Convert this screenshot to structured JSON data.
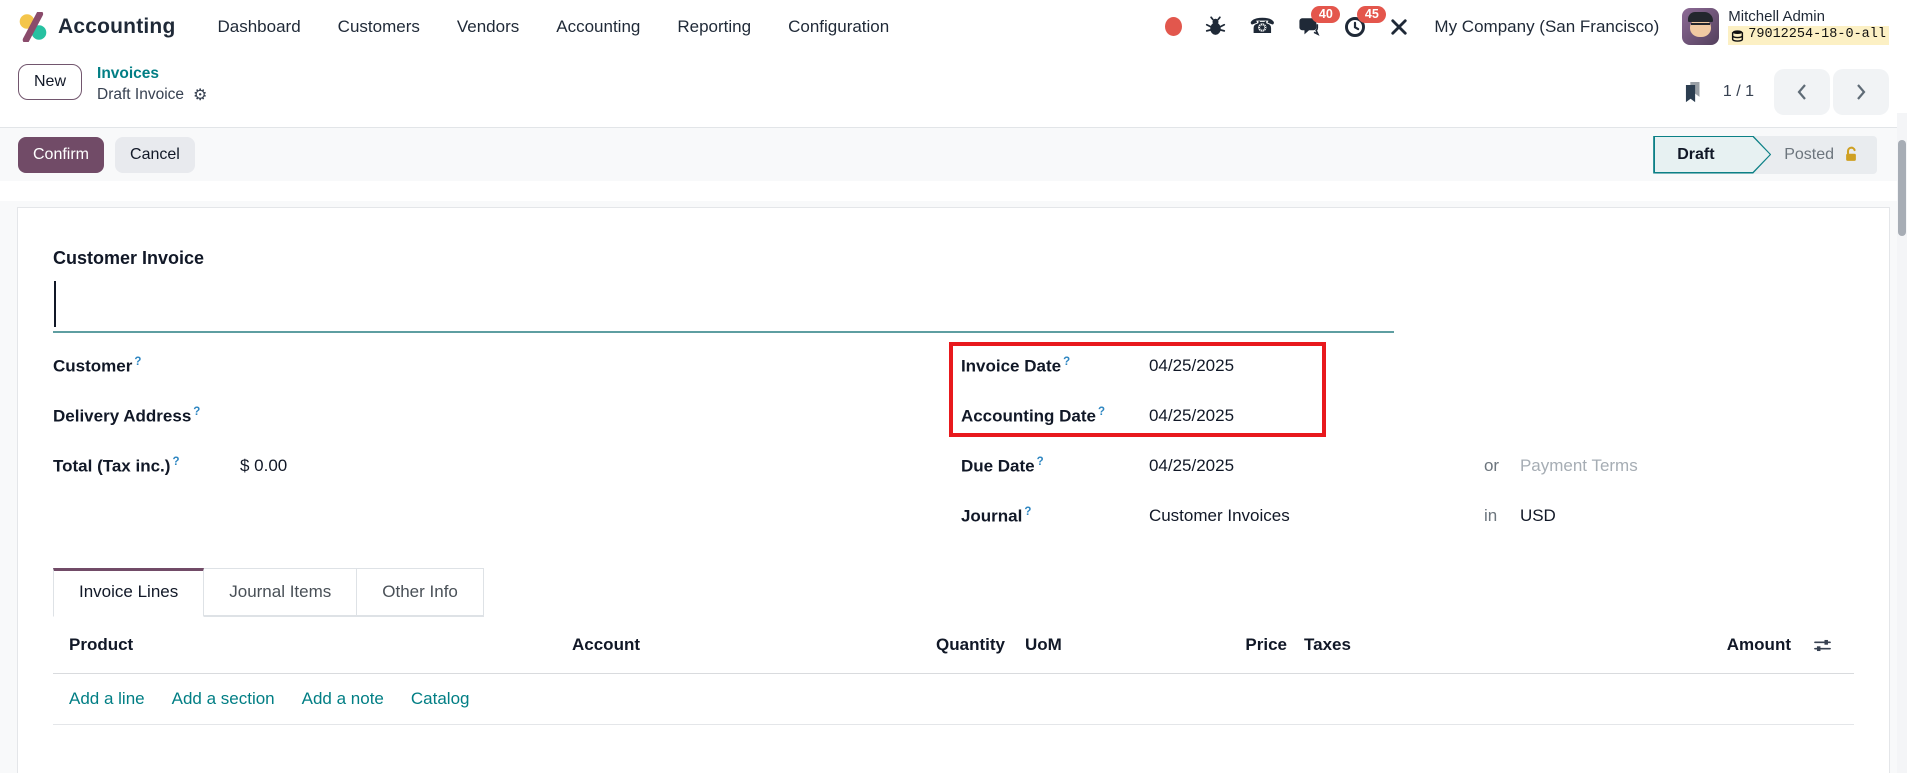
{
  "nav": {
    "brand": "Accounting",
    "menus": [
      "Dashboard",
      "Customers",
      "Vendors",
      "Accounting",
      "Reporting",
      "Configuration"
    ],
    "chat_badge": "40",
    "activity_badge": "45",
    "company": "My Company (San Francisco)",
    "user_name": "Mitchell Admin",
    "session": "79012254-18-0-all"
  },
  "breadcrumb": {
    "new_label": "New",
    "parent": "Invoices",
    "current": "Draft Invoice",
    "pager": "1 / 1"
  },
  "statusbar": {
    "confirm": "Confirm",
    "cancel": "Cancel",
    "draft": "Draft",
    "posted": "Posted"
  },
  "sheet": {
    "title": "Customer Invoice"
  },
  "fields": {
    "help": "?",
    "customer": {
      "label": "Customer"
    },
    "delivery": {
      "label": "Delivery Address"
    },
    "total": {
      "label": "Total (Tax inc.)",
      "value": "$ 0.00"
    },
    "invoice_date": {
      "label": "Invoice Date",
      "value": "04/25/2025"
    },
    "accounting_date": {
      "label": "Accounting Date",
      "value": "04/25/2025"
    },
    "due_date": {
      "label": "Due Date",
      "value": "04/25/2025",
      "or": "or",
      "payment_terms": "Payment Terms"
    },
    "journal": {
      "label": "Journal",
      "value": "Customer Invoices",
      "in": "in",
      "currency": "USD"
    }
  },
  "tabs": [
    "Invoice Lines",
    "Journal Items",
    "Other Info"
  ],
  "table": {
    "headers": [
      "Product",
      "Account",
      "Quantity",
      "UoM",
      "Price",
      "Taxes",
      "Amount"
    ]
  },
  "links": [
    "Add a line",
    "Add a section",
    "Add a note",
    "Catalog"
  ],
  "colors": {
    "primary": "#714B67",
    "teal_link": "#017E84",
    "badge_red": "#e4564c",
    "annotation_red": "#e8191d",
    "status_teal": "#0c8086",
    "lock_gold": "#cfa023",
    "session_highlight": "#fcf0c4"
  }
}
